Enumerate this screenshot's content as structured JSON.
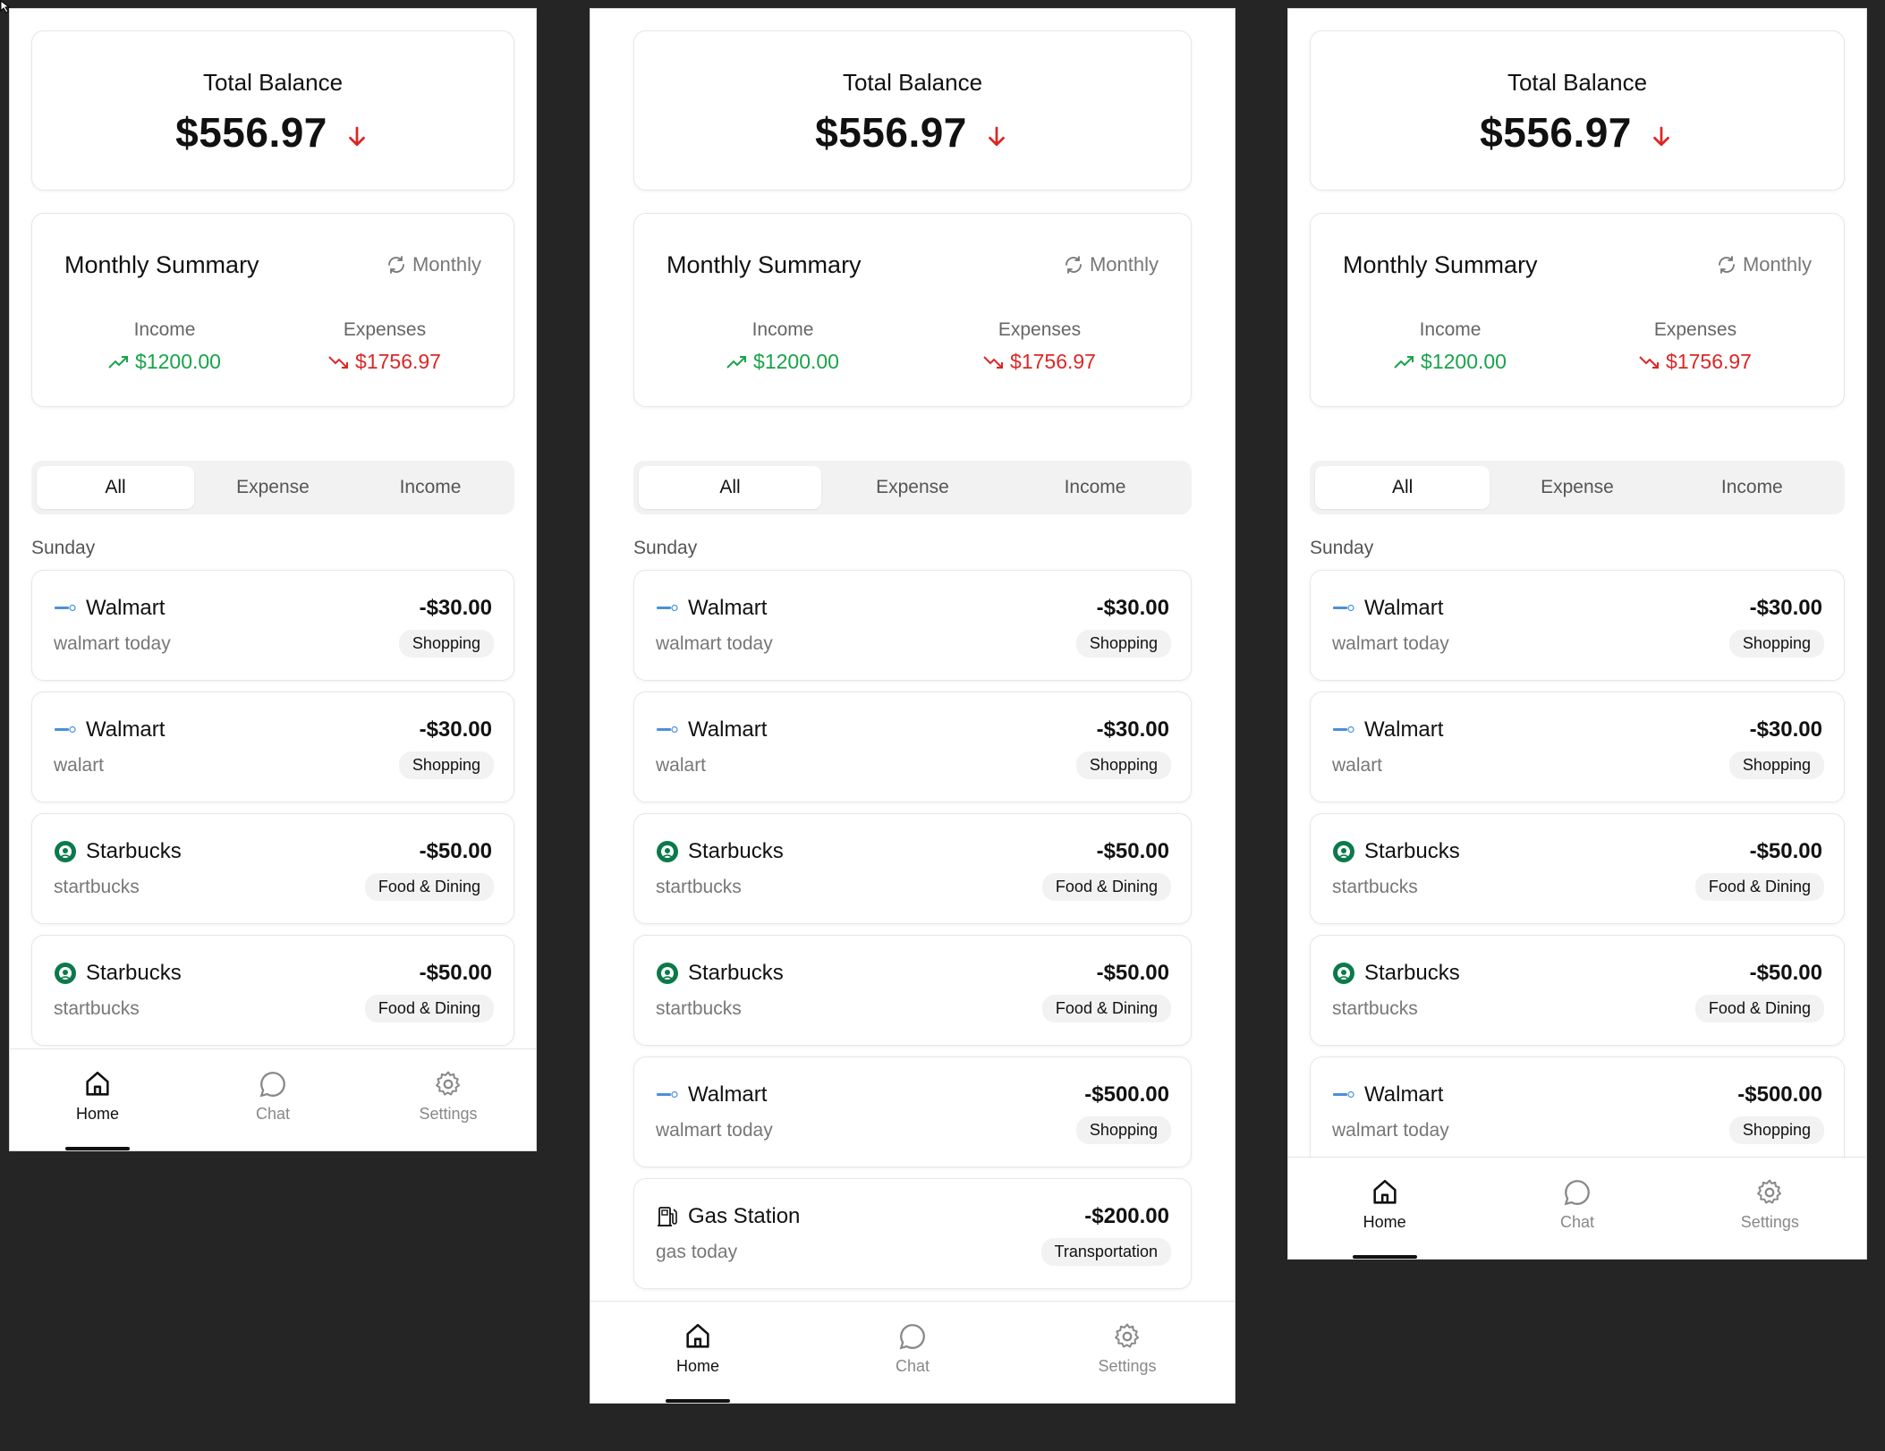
{
  "balance": {
    "title": "Total Balance",
    "amount": "$556.97"
  },
  "summary": {
    "title": "Monthly Summary",
    "period": "Monthly",
    "income_label": "Income",
    "income_value": "$1200.00",
    "expenses_label": "Expenses",
    "expenses_value": "$1756.97"
  },
  "filters": [
    "All",
    "Expense",
    "Income"
  ],
  "day": "Sunday",
  "transactions": [
    {
      "merchant": "Walmart",
      "note": "walmart today",
      "amount": "-$30.00",
      "category": "Shopping",
      "icon": "walmart-logo-icon"
    },
    {
      "merchant": "Walmart",
      "note": "walart",
      "amount": "-$30.00",
      "category": "Shopping",
      "icon": "walmart-logo-icon"
    },
    {
      "merchant": "Starbucks",
      "note": "startbucks",
      "amount": "-$50.00",
      "category": "Food & Dining",
      "icon": "starbucks-logo-icon"
    },
    {
      "merchant": "Starbucks",
      "note": "startbucks",
      "amount": "-$50.00",
      "category": "Food & Dining",
      "icon": "starbucks-logo-icon"
    },
    {
      "merchant": "Walmart",
      "note": "walmart today",
      "amount": "-$500.00",
      "category": "Shopping",
      "icon": "walmart-logo-icon"
    },
    {
      "merchant": "Gas Station",
      "note": "gas today",
      "amount": "-$200.00",
      "category": "Transportation",
      "icon": "gas-station-icon"
    }
  ],
  "nav": {
    "home": "Home",
    "chat": "Chat",
    "settings": "Settings"
  },
  "colors": {
    "income": "#17a34a",
    "expense": "#dc2626",
    "background": "#252525"
  }
}
